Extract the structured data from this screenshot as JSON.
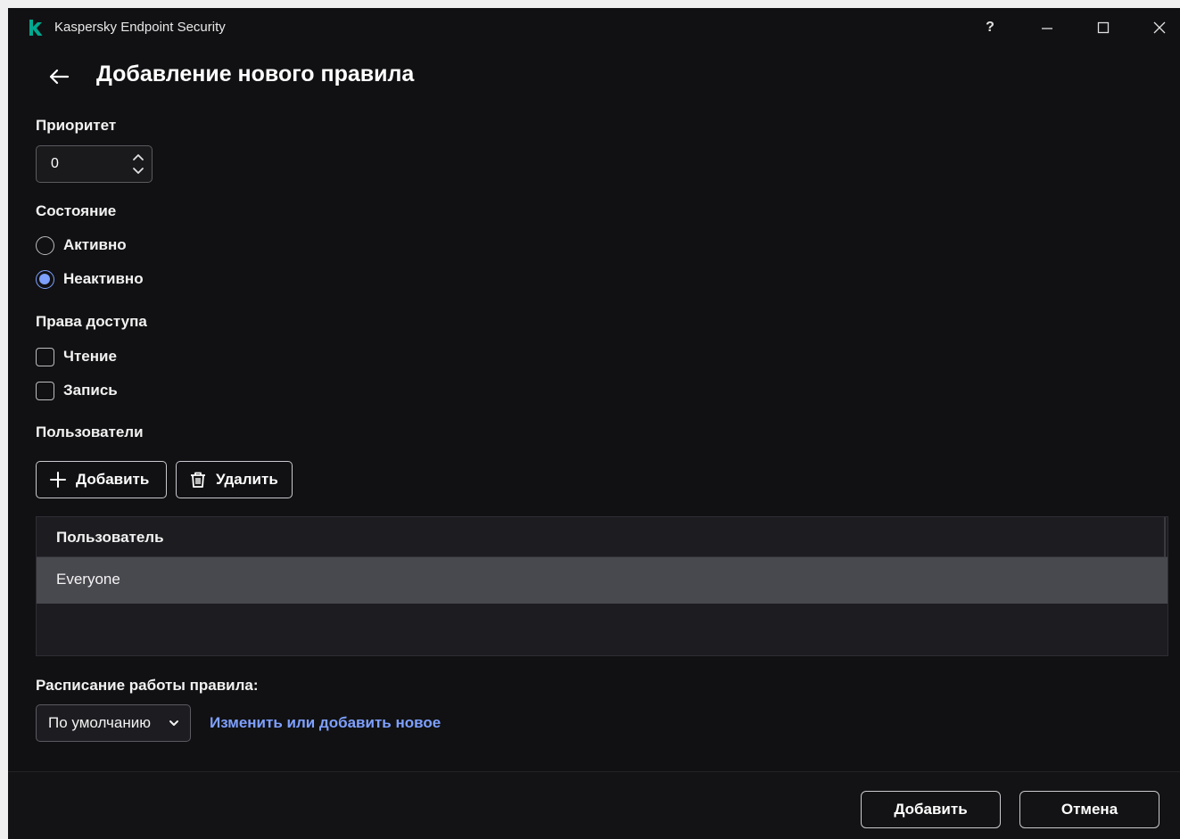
{
  "window": {
    "app_title": "Kaspersky Endpoint Security",
    "help_label": "?",
    "accent_color": "#7ea0ff",
    "logo_color": "#00a88e"
  },
  "header": {
    "title": "Добавление нового правила"
  },
  "priority": {
    "label": "Приоритет",
    "value": "0"
  },
  "state": {
    "label": "Состояние",
    "options": [
      {
        "label": "Активно",
        "checked": false
      },
      {
        "label": "Неактивно",
        "checked": true
      }
    ]
  },
  "access": {
    "label": "Права доступа",
    "options": [
      {
        "label": "Чтение",
        "checked": false
      },
      {
        "label": "Запись",
        "checked": false
      }
    ]
  },
  "users": {
    "label": "Пользователи",
    "add_label": "Добавить",
    "delete_label": "Удалить",
    "column_header": "Пользователь",
    "rows": [
      "Everyone"
    ]
  },
  "schedule": {
    "label": "Расписание работы правила:",
    "selected": "По умолчанию",
    "link_label": "Изменить или добавить новое"
  },
  "footer": {
    "confirm_label": "Добавить",
    "cancel_label": "Отмена"
  }
}
